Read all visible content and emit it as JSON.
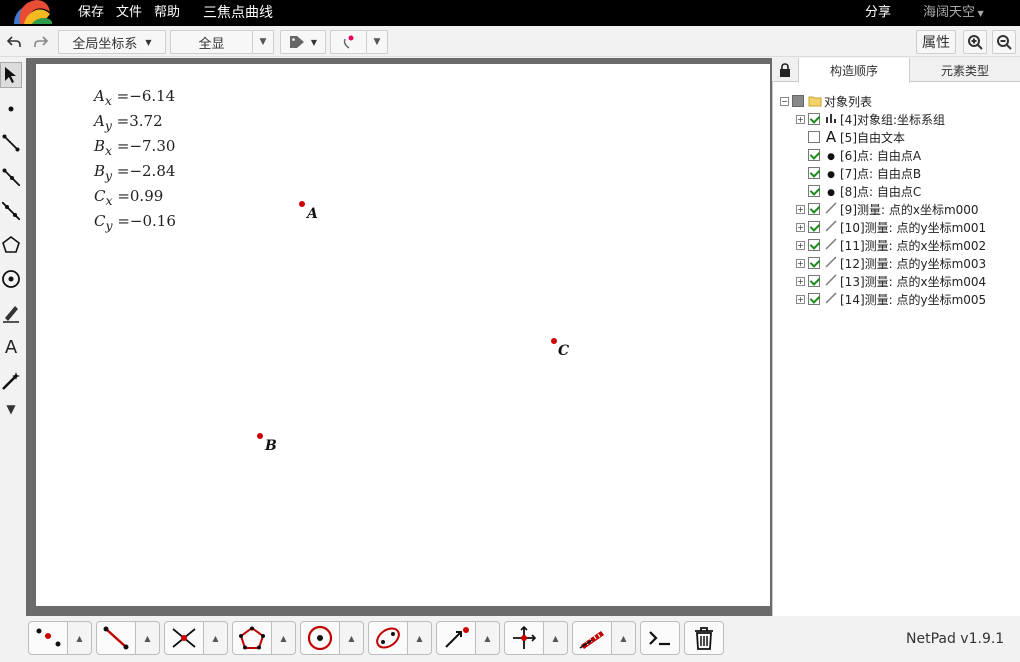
{
  "menu": {
    "save": "保存",
    "file": "文件",
    "help": "帮助",
    "doc_title": "三焦点曲线",
    "share": "分享",
    "user": "海阔天空"
  },
  "toolbar": {
    "coord_system": "全局坐标系",
    "show_all": "全显",
    "properties": "属性"
  },
  "canvas": {
    "measurements": [
      {
        "var": "A",
        "sub": "x",
        "value": "−6.14"
      },
      {
        "var": "A",
        "sub": "y",
        "value": "3.72"
      },
      {
        "var": "B",
        "sub": "x",
        "value": "−7.30"
      },
      {
        "var": "B",
        "sub": "y",
        "value": "−2.84"
      },
      {
        "var": "C",
        "sub": "x",
        "value": "0.99"
      },
      {
        "var": "C",
        "sub": "y",
        "value": "−0.16"
      }
    ],
    "points": [
      {
        "label": "A"
      },
      {
        "label": "B"
      },
      {
        "label": "C"
      }
    ],
    "point_color": "#d00000"
  },
  "panel": {
    "tabs": [
      "构造顺序",
      "元素类型"
    ],
    "root": "对象列表",
    "items": [
      {
        "text": "[4]对象组:坐标系组",
        "expand": true,
        "checked": true,
        "icon": "chart-icon"
      },
      {
        "text": "[5]自由文本",
        "expand": false,
        "checked": false,
        "icon": "text-icon"
      },
      {
        "text": "[6]点: 自由点A",
        "expand": false,
        "checked": true,
        "icon": "point-icon"
      },
      {
        "text": "[7]点: 自由点B",
        "expand": false,
        "checked": true,
        "icon": "point-icon"
      },
      {
        "text": "[8]点: 自由点C",
        "expand": false,
        "checked": true,
        "icon": "point-icon"
      },
      {
        "text": "[9]测量: 点的x坐标m000",
        "expand": true,
        "checked": true,
        "icon": "measure-icon"
      },
      {
        "text": "[10]测量: 点的y坐标m001",
        "expand": true,
        "checked": true,
        "icon": "measure-icon"
      },
      {
        "text": "[11]测量: 点的x坐标m002",
        "expand": true,
        "checked": true,
        "icon": "measure-icon"
      },
      {
        "text": "[12]测量: 点的y坐标m003",
        "expand": true,
        "checked": true,
        "icon": "measure-icon"
      },
      {
        "text": "[13]测量: 点的x坐标m004",
        "expand": true,
        "checked": true,
        "icon": "measure-icon"
      },
      {
        "text": "[14]测量: 点的y坐标m005",
        "expand": true,
        "checked": true,
        "icon": "measure-icon"
      }
    ]
  },
  "version": "NetPad v1.9.1"
}
